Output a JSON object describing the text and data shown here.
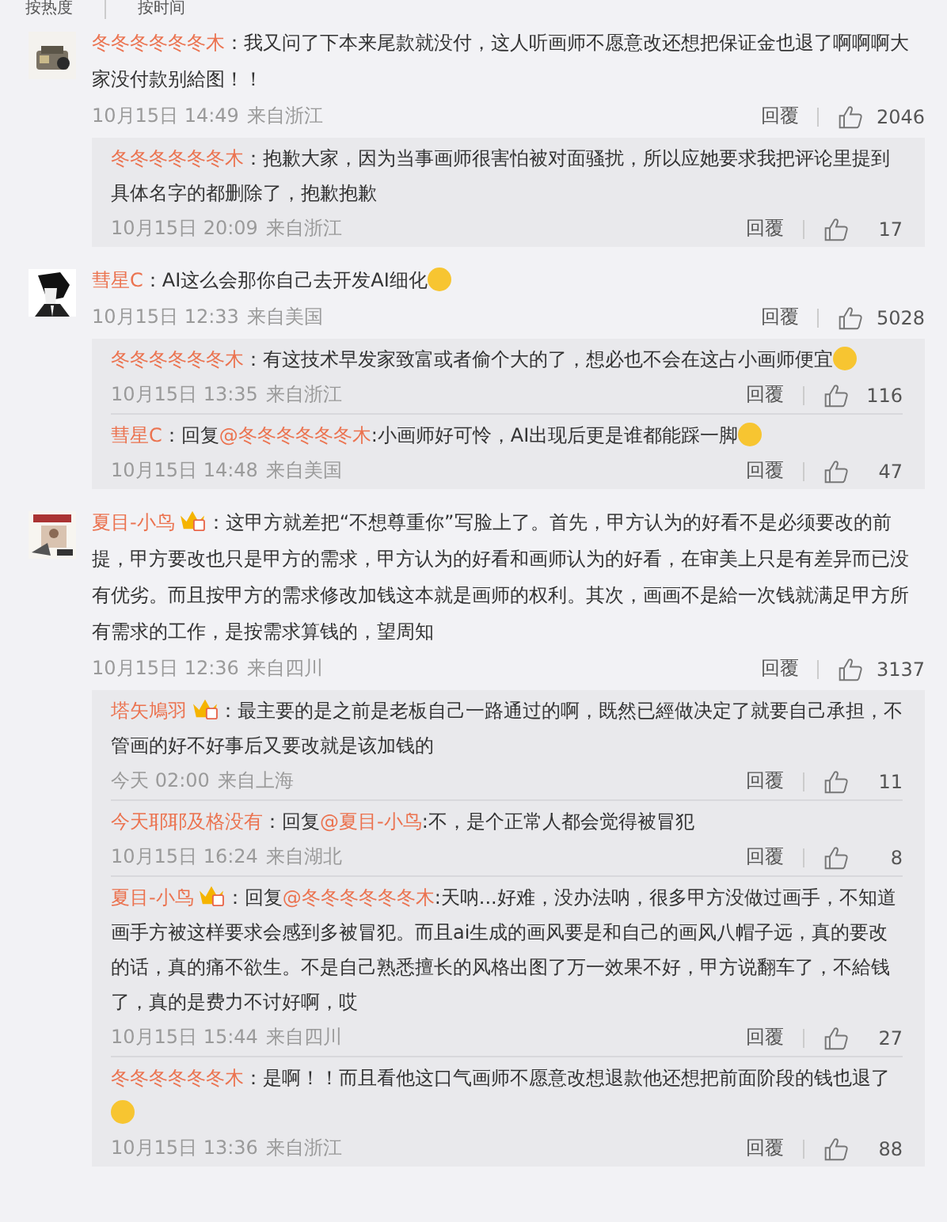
{
  "sort_tabs": [
    "按热度",
    "按时间"
  ],
  "comments": [
    {
      "name": "冬冬冬冬冬冬木",
      "vip": false,
      "text": "：我又问了下本来尾款就没付，这人听画师不愿意改还想把保证金也退了啊啊啊大家没付款别給图！！",
      "emoji": false,
      "date": "10月15日 14:49",
      "location": "来自浙江",
      "reply_label": "回覆",
      "likes": "2046",
      "replies": [
        {
          "name": "冬冬冬冬冬冬木",
          "vip": false,
          "text": "：抱歉大家，因为当事画师很害怕被对面骚扰，所以应她要求我把评论里提到具体名字的都删除了，抱歉抱歉",
          "emoji": false,
          "date": "10月15日 20:09",
          "location": "来自浙江",
          "reply_label": "回覆",
          "likes": "17"
        }
      ]
    },
    {
      "name": "彗星C",
      "vip": false,
      "text": "：AI这么会那你自己去开发AI细化",
      "emoji": true,
      "date": "10月15日 12:33",
      "location": "来自美国",
      "reply_label": "回覆",
      "likes": "5028",
      "replies": [
        {
          "name": "冬冬冬冬冬冬木",
          "vip": false,
          "text": "：有这技术早发家致富或者偷个大的了，想必也不会在这占小画师便宜",
          "emoji": true,
          "date": "10月15日 13:35",
          "location": "来自浙江",
          "reply_label": "回覆",
          "likes": "116"
        },
        {
          "name": "彗星C",
          "vip": false,
          "prefix": "：回复",
          "mention": "@冬冬冬冬冬冬木",
          "text": ":小画师好可怜，AI出现后更是谁都能踩一脚",
          "emoji": true,
          "date": "10月15日 14:48",
          "location": "来自美国",
          "reply_label": "回覆",
          "likes": "47"
        }
      ]
    },
    {
      "name": "夏目-小鸟",
      "vip": true,
      "text": "：这甲方就差把“不想尊重你”写脸上了。首先，甲方认为的好看不是必须要改的前提，甲方要改也只是甲方的需求，甲方认为的好看和画师认为的好看，在审美上只是有差异而已没有优劣。而且按甲方的需求修改加钱这本就是画师的权利。其次，画画不是給一次钱就满足甲方所有需求的工作，是按需求算钱的，望周知",
      "emoji": false,
      "date": "10月15日 12:36",
      "location": "来自四川",
      "reply_label": "回覆",
      "likes": "3137",
      "replies": [
        {
          "name": "塔矢鳩羽",
          "vip": true,
          "text": "：最主要的是之前是老板自己一路通过的啊，既然已經做决定了就要自己承担，不管画的好不好事后又要改就是该加钱的",
          "emoji": false,
          "date": "今天 02:00",
          "location": "来自上海",
          "reply_label": "回覆",
          "likes": "11"
        },
        {
          "name": "今天耶耶及格没有",
          "vip": false,
          "prefix": "：回复",
          "mention": "@夏目-小鸟",
          "text": ":不，是个正常人都会觉得被冒犯",
          "emoji": false,
          "date": "10月15日 16:24",
          "location": "来自湖北",
          "reply_label": "回覆",
          "likes": "8"
        },
        {
          "name": "夏目-小鸟",
          "vip": true,
          "prefix": "：回复",
          "mention": "@冬冬冬冬冬冬木",
          "text": ":天呐...好难，没办法呐，很多甲方没做过画手，不知道画手方被这样要求会感到多被冒犯。而且ai生成的画风要是和自己的画风八帽子远，真的要改的话，真的痛不欲生。不是自己熟悉擅长的风格出图了万一效果不好，甲方说翻车了，不給钱了，真的是费力不讨好啊，哎",
          "emoji": false,
          "date": "10月15日 15:44",
          "location": "来自四川",
          "reply_label": "回覆",
          "likes": "27"
        },
        {
          "name": "冬冬冬冬冬冬木",
          "vip": false,
          "text": "：是啊！！而且看他这口气画师不愿意改想退款他还想把前面阶段的钱也退了",
          "emoji": true,
          "date": "10月15日 13:36",
          "location": "来自浙江",
          "reply_label": "回覆",
          "likes": "88"
        }
      ]
    }
  ]
}
